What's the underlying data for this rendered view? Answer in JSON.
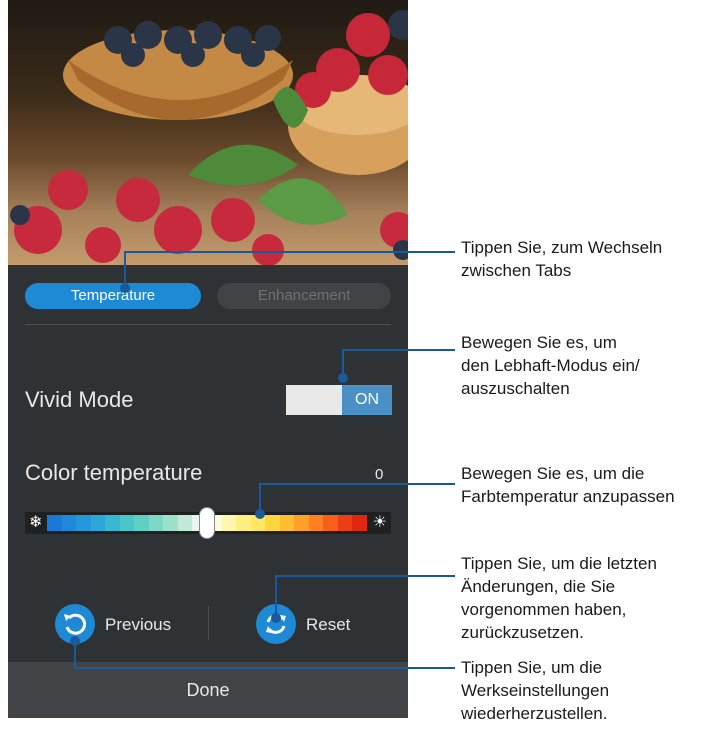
{
  "tabs": {
    "active": "Temperature",
    "inactive": "Enhancement"
  },
  "vivid_mode": {
    "label": "Vivid Mode",
    "toggle": "ON"
  },
  "color_temperature": {
    "label": "Color temperature",
    "value": "0",
    "level_fraction": 0.5
  },
  "buttons": {
    "previous": "Previous",
    "reset": "Reset",
    "done": "Done"
  },
  "callouts": {
    "tabs": [
      "Tippen Sie, zum Wechseln",
      "zwischen Tabs"
    ],
    "vivid": [
      "Bewegen Sie es, um",
      "den Lebhaft-Modus ein/",
      "auszuschalten"
    ],
    "temperature": [
      "Bewegen Sie es, um die",
      "Farbtemperatur anzupassen"
    ],
    "reset": [
      "Tippen Sie, um die letzten",
      "Änderungen, die Sie",
      "vorgenommen haben,",
      "zurückzusetzen."
    ],
    "previous": [
      "Tippen Sie, um die",
      "Werkseinstellungen",
      "wiederherzustellen."
    ]
  },
  "colors": {
    "accent": "#1e8ad6",
    "callout_line": "#1a5a9a",
    "panel": "#2f3234"
  },
  "icons": {
    "cold": "snowflake-icon",
    "warm": "sun-icon",
    "previous": "undo-icon",
    "reset": "refresh-icon"
  }
}
